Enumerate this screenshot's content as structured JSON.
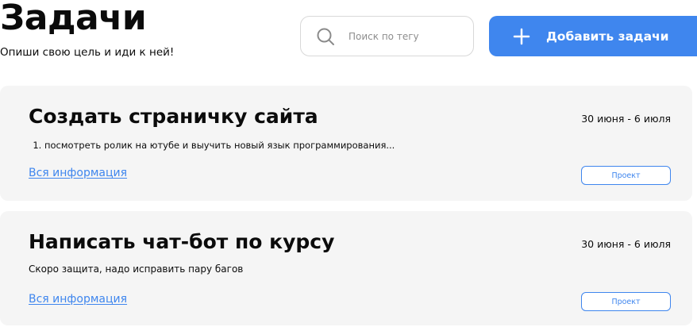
{
  "header": {
    "title": "Задачи",
    "subtitle": "Опиши свою цель и иди к ней!"
  },
  "search": {
    "icon": "search-icon",
    "placeholder": "Поиск по тегу",
    "value": ""
  },
  "toolbar": {
    "add_icon": "plus-icon",
    "add_label": "Добавить задачи"
  },
  "colors": {
    "accent": "#3f86ee",
    "card_background": "#f5f5f5",
    "text": "#0b0b0b"
  },
  "tasks": [
    {
      "title": "Создать страничку сайта",
      "dates": "30 июня - 6 июля",
      "items": [
        "посмотреть ролик на ютубе и выучить новый язык программирования..."
      ],
      "link_label": "Вся информация",
      "tag": "Проект"
    },
    {
      "title": "Написать чат-бот по курсу",
      "dates": "30 июня - 6 июля",
      "description": "Скоро защита, надо исправить пару багов",
      "link_label": "Вся информация",
      "tag": "Проект"
    }
  ]
}
